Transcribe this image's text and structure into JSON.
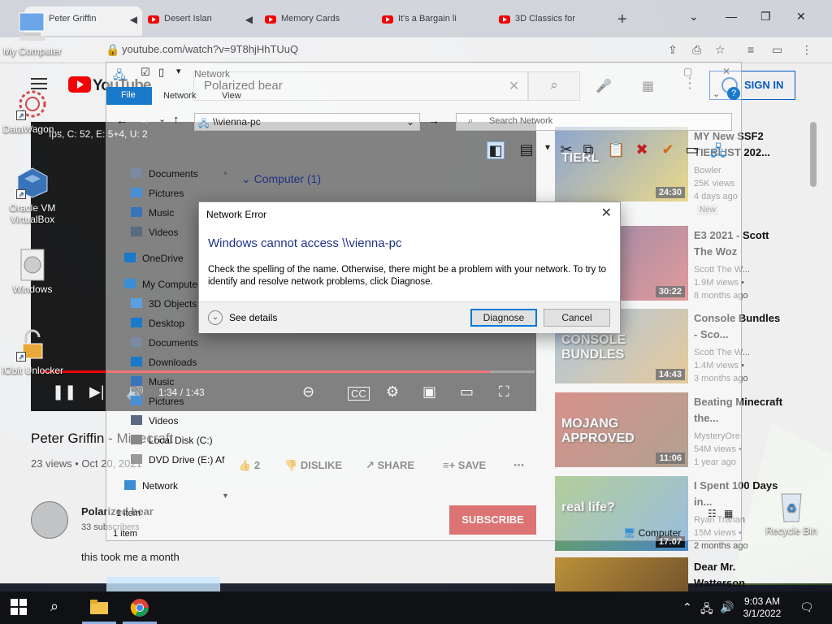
{
  "desktop": {
    "icons": [
      {
        "label": "My Computer"
      },
      {
        "label": "DataWagon..."
      },
      {
        "label": "Oracle VM VirtualBox"
      },
      {
        "label": "Windows"
      },
      {
        "label": "IObit Unlocker"
      },
      {
        "label": "Recycle Bin"
      }
    ]
  },
  "browser": {
    "tabs": [
      {
        "label": "Peter Griffin"
      },
      {
        "label": "Desert Islan"
      },
      {
        "label": "Memory Cards"
      },
      {
        "label": "It's a Bargain li"
      },
      {
        "label": "3D Classics for"
      }
    ],
    "url": "youtube.com/watch?v=9T8hjHhTUuQ",
    "search_value": "Polarized bear",
    "signin_label": "SIGN IN",
    "stats_overlay": "fps, C: 52, E: 5+4, U: 2",
    "video": {
      "time": "1:34 / 1:43",
      "progress": 0.91,
      "title": "Peter Griffin - Minecraft",
      "meta": "23 views • Oct 20, 2021",
      "likes": "2",
      "dislike_label": "DISLIKE",
      "share_label": "SHARE",
      "save_label": "SAVE"
    },
    "channel": {
      "name": "Polarized bear",
      "subs": "33 subscribers",
      "subscribe_label": "SUBSCRIBE",
      "description": "this took me a month"
    },
    "recommendations": [
      {
        "title": "MY New SSF2 TIERLIST 202...",
        "channel": "Bowler",
        "views": "25K views",
        "age": "4 days ago",
        "badge": "New",
        "duration": "24:30",
        "thumb_text": "TIERL",
        "colors": [
          "#2f5fb3",
          "#e6c42a"
        ]
      },
      {
        "title": "E3 2021 - Scott The Woz",
        "channel": "Scott The W...",
        "views": "1.9M views •",
        "age": "8 months ago",
        "badge": "",
        "duration": "30:22",
        "thumb_text": "E32021",
        "colors": [
          "#3a2a6a",
          "#d94a4a"
        ]
      },
      {
        "title": "Console Bundles - Sco...",
        "channel": "Scott The W...",
        "views": "1.4M views •",
        "age": "3 months ago",
        "badge": "",
        "duration": "14:43",
        "thumb_text": "CONSOLE BUNDLES",
        "colors": [
          "#6ea0cf",
          "#e0a84a"
        ]
      },
      {
        "title": "Beating Minecraft the...",
        "channel": "MysteryOre",
        "views": "54M views •",
        "age": "1 year ago",
        "badge": "",
        "duration": "11:06",
        "thumb_text": "MOJANG APPROVED",
        "colors": [
          "#c0392b",
          "#7a5a3a"
        ]
      },
      {
        "title": "I Spent 100 Days in...",
        "channel": "Ryan Trahan",
        "views": "15M views •",
        "age": "2 months ago",
        "badge": "",
        "duration": "17:07",
        "thumb_text": "real life?",
        "colors": [
          "#7bb04a",
          "#4a8fd4"
        ]
      },
      {
        "title": "Dear Mr. Watterson",
        "channel": "",
        "views": "",
        "age": "",
        "badge": "",
        "duration": "",
        "thumb_text": "",
        "colors": [
          "#c89a3a",
          "#6a4a2a"
        ]
      }
    ]
  },
  "explorer": {
    "title": "Network",
    "ribbon_tabs": [
      "File",
      "Network",
      "View"
    ],
    "path": "\\\\vienna-pc",
    "search_placeholder": "Search Network",
    "group_header": "Computer (1)",
    "sidebar": [
      "Documents",
      "Pictures",
      "Music",
      "Videos",
      "OneDrive",
      "My Compute",
      "3D Objects",
      "Desktop",
      "Documents",
      "Downloads",
      "Music",
      "Pictures",
      "Videos",
      "Local Disk (C:)",
      "DVD Drive (E:) Af",
      "Network"
    ],
    "items_count": "1 item",
    "status": "1 item",
    "computer_item": "Computer"
  },
  "dialog": {
    "title": "Network Error",
    "heading": "Windows cannot access \\\\vienna-pc",
    "message": "Check the spelling of the name. Otherwise, there might be a problem with your network. To try to identify and resolve network problems, click Diagnose.",
    "details_label": "See details",
    "diagnose_label": "Diagnose",
    "cancel_label": "Cancel"
  },
  "taskbar": {
    "time": "9:03 AM",
    "date": "3/1/2022"
  }
}
